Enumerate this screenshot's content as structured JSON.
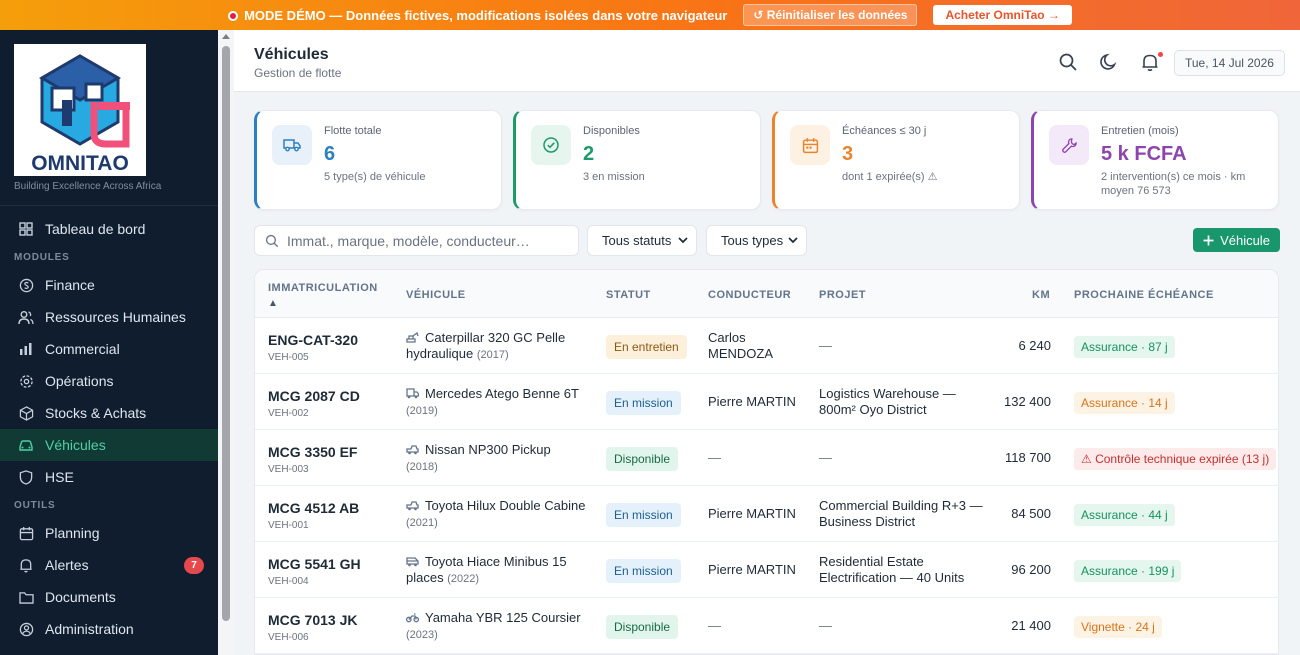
{
  "banner": {
    "text": "MODE DÉMO — Données fictives, modifications isolées dans votre navigateur",
    "reset_label": "↺ Réinitialiser les données",
    "buy_label": "Acheter OmniTao →"
  },
  "brand": {
    "name": "OMNITAO",
    "tagline": "Building Excellence Across Africa"
  },
  "sidebar": {
    "dashboard": "Tableau de bord",
    "section_modules": "MODULES",
    "modules": [
      {
        "label": "Finance",
        "icon": "finance-icon"
      },
      {
        "label": "Ressources Humaines",
        "icon": "users-icon"
      },
      {
        "label": "Commercial",
        "icon": "bar-chart-icon"
      },
      {
        "label": "Opérations",
        "icon": "gear-icon"
      },
      {
        "label": "Stocks & Achats",
        "icon": "box-icon"
      },
      {
        "label": "Véhicules",
        "icon": "car-icon"
      },
      {
        "label": "HSE",
        "icon": "shield-icon"
      }
    ],
    "section_tools": "OUTILS",
    "tools": [
      {
        "label": "Planning",
        "icon": "calendar-icon"
      },
      {
        "label": "Alertes",
        "icon": "bell-icon",
        "badge": "7"
      },
      {
        "label": "Documents",
        "icon": "folder-icon"
      },
      {
        "label": "Administration",
        "icon": "admin-icon"
      }
    ]
  },
  "header": {
    "title": "Véhicules",
    "subtitle": "Gestion de flotte",
    "date": "Tue, 14 Jul 2026"
  },
  "kpis": [
    {
      "label": "Flotte totale",
      "value": "6",
      "sub": "5 type(s) de véhicule",
      "color": "#2d7fc1"
    },
    {
      "label": "Disponibles",
      "value": "2",
      "sub": "3 en mission",
      "color": "#1e9a6a"
    },
    {
      "label": "Échéances ≤ 30 j",
      "value": "3",
      "sub": "dont 1 expirée(s) ⚠",
      "color": "#e8852b"
    },
    {
      "label": "Entretien (mois)",
      "value": "5 k FCFA",
      "sub": "2 intervention(s) ce mois · km moyen 76 573",
      "color": "#8e44ad"
    }
  ],
  "filters": {
    "search_placeholder": "Immat., marque, modèle, conducteur…",
    "status_select": "Tous statuts",
    "type_select": "Tous types",
    "add_label": "Véhicule"
  },
  "table": {
    "headers": {
      "plate": "IMMATRICULATION",
      "sort": "▲",
      "vehicle": "VÉHICULE",
      "status": "STATUT",
      "driver": "CONDUCTEUR",
      "project": "PROJET",
      "km": "KM",
      "due": "PROCHAINE ÉCHÉANCE"
    },
    "rows": [
      {
        "plate": "ENG-CAT-320",
        "id": "VEH-005",
        "vehicle": "Caterpillar 320 GC Pelle hydraulique",
        "year": "(2017)",
        "status": "En entretien",
        "driver": "Carlos MENDOZA",
        "project": "—",
        "km": "6 240",
        "due": "Assurance · 87 j"
      },
      {
        "plate": "MCG 2087 CD",
        "id": "VEH-002",
        "vehicle": "Mercedes Atego Benne 6T",
        "year": "(2019)",
        "status": "En mission",
        "driver": "Pierre MARTIN",
        "project": "Logistics Warehouse — 800m² Oyo District",
        "km": "132 400",
        "due": "Assurance · 14 j"
      },
      {
        "plate": "MCG 3350 EF",
        "id": "VEH-003",
        "vehicle": "Nissan NP300 Pickup",
        "year": "(2018)",
        "status": "Disponible",
        "driver": "—",
        "project": "—",
        "km": "118 700",
        "due": "⚠ Contrôle technique expirée (13 j)"
      },
      {
        "plate": "MCG 4512 AB",
        "id": "VEH-001",
        "vehicle": "Toyota Hilux Double Cabine",
        "year": "(2021)",
        "status": "En mission",
        "driver": "Pierre MARTIN",
        "project": "Commercial Building R+3 — Business District",
        "km": "84 500",
        "due": "Assurance · 44 j"
      },
      {
        "plate": "MCG 5541 GH",
        "id": "VEH-004",
        "vehicle": "Toyota Hiace Minibus 15 places",
        "year": "(2022)",
        "status": "En mission",
        "driver": "Pierre MARTIN",
        "project": "Residential Estate Electrification — 40 Units",
        "km": "96 200",
        "due": "Assurance · 199 j"
      },
      {
        "plate": "MCG 7013 JK",
        "id": "VEH-006",
        "vehicle": "Yamaha YBR 125 Coursier",
        "year": "(2023)",
        "status": "Disponible",
        "driver": "—",
        "project": "—",
        "km": "21 400",
        "due": "Vignette · 24 j"
      }
    ]
  }
}
